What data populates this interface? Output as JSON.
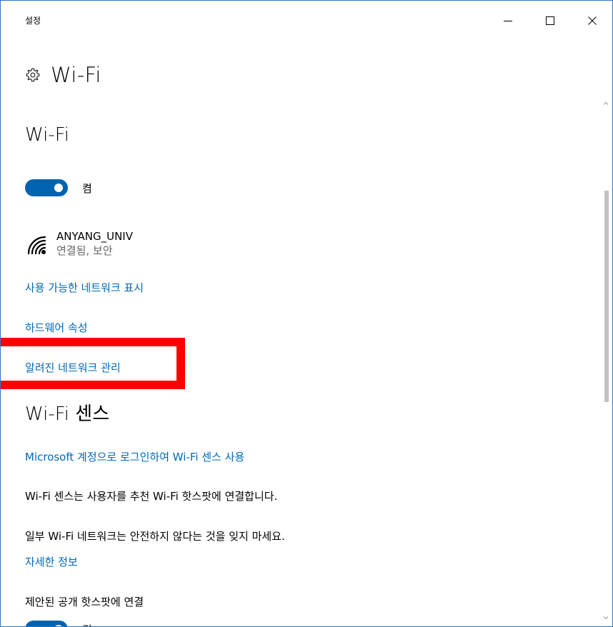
{
  "window": {
    "title": "설정",
    "controls": {
      "minimize_icon": "minimize-icon",
      "maximize_icon": "maximize-icon",
      "close_icon": "close-icon"
    }
  },
  "header": {
    "icon": "gear-icon",
    "title": "Wi-Fi"
  },
  "wifi_section": {
    "title": "Wi-Fi",
    "toggle": {
      "state": "on",
      "label": "켬"
    },
    "connected_network": {
      "icon": "wifi-signal-icon",
      "name": "ANYANG_UNIV",
      "status": "연결됨, 보안"
    },
    "links": {
      "show_available": "사용 가능한 네트워크 표시",
      "hardware_properties": "하드웨어 속성",
      "manage_known": "알려진 네트워크 관리"
    }
  },
  "wifi_sense": {
    "title": "Wi-Fi 센스",
    "signin_link": "Microsoft 계정으로 로그인하여 Wi-Fi 센스 사용",
    "description": "Wi-Fi 센스는 사용자를 추천 Wi-Fi 핫스팟에 연결합니다.",
    "warning": "일부 Wi-Fi 네트워크는 안전하지 않다는 것을 잊지 마세요.",
    "more_info_link": "자세한 정보",
    "hotspot_label": "제안된 공개 핫스팟에 연결",
    "hotspot_toggle_label": "켬"
  },
  "colors": {
    "accent": "#0063b1",
    "link": "#0067b8",
    "highlight": "#ff0000",
    "window_border": "#2b78c5"
  }
}
